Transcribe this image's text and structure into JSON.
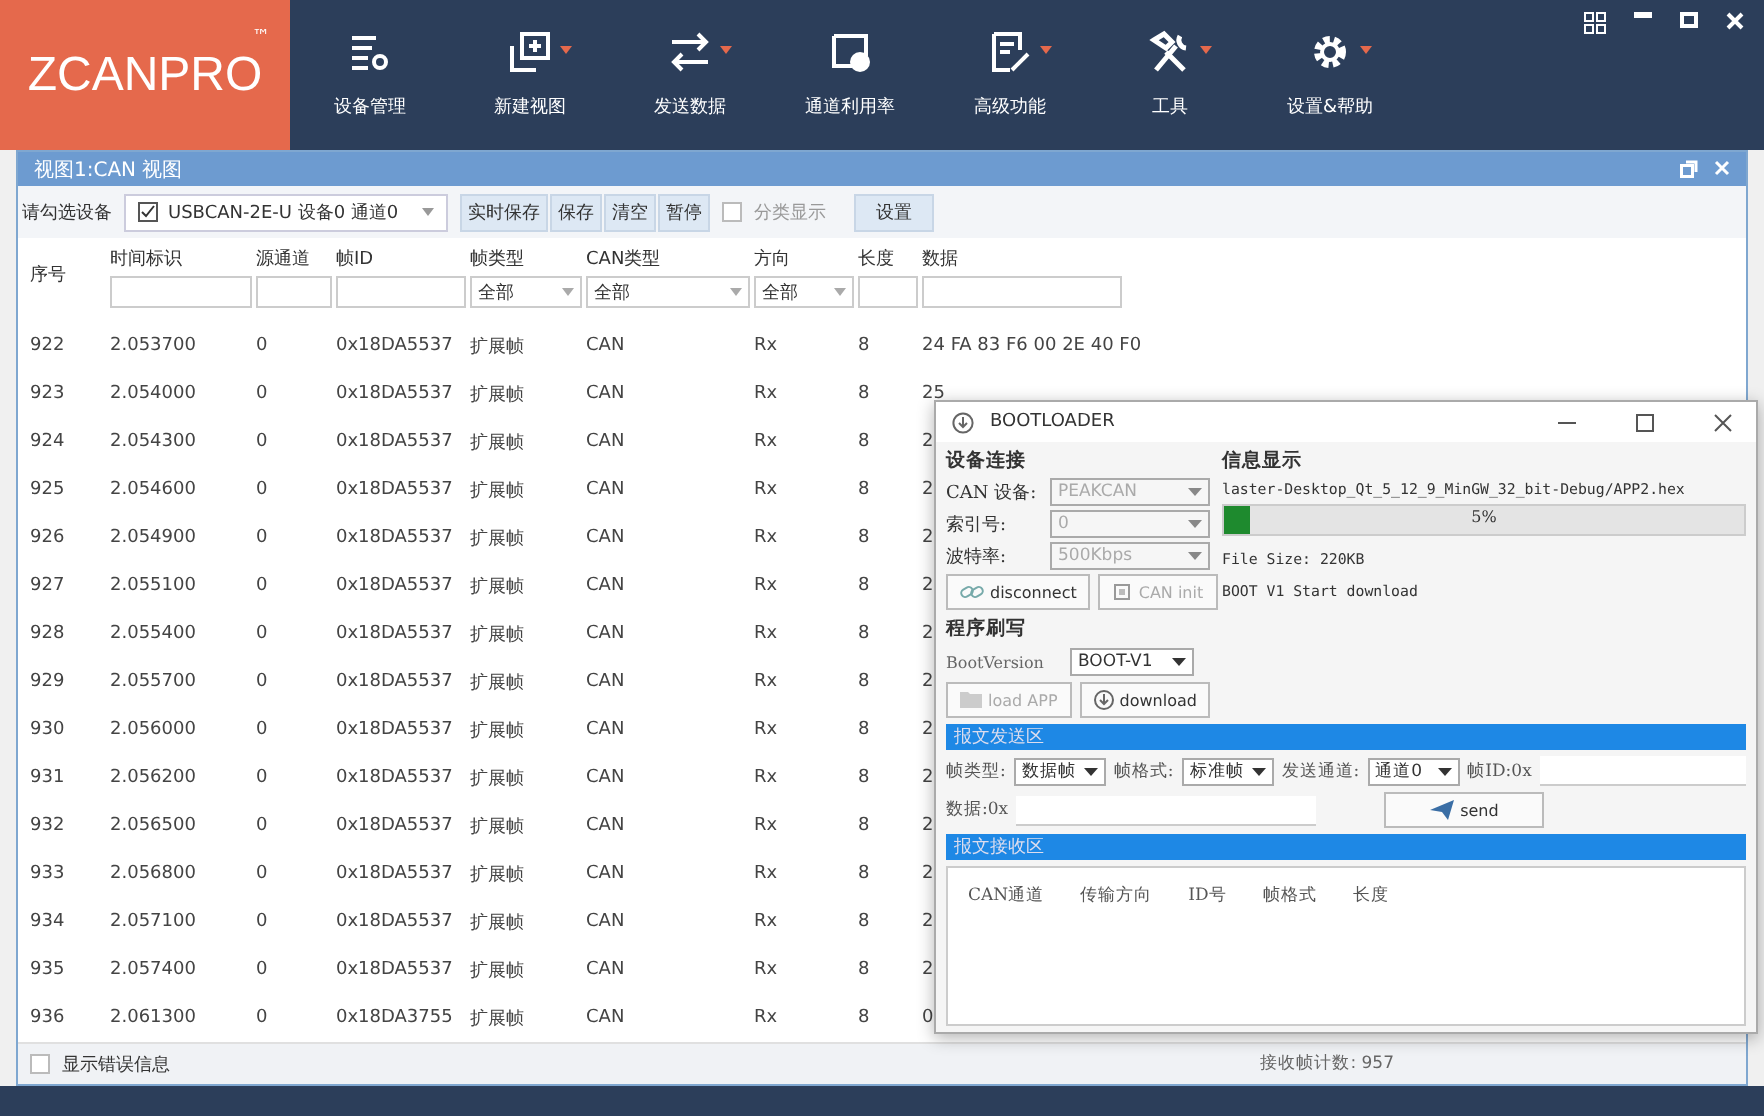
{
  "app": {
    "logo": "ZCANPRO",
    "logo_mark": "™",
    "toolbar": [
      {
        "label": "设备管理",
        "dropdown": false
      },
      {
        "label": "新建视图",
        "dropdown": true
      },
      {
        "label": "发送数据",
        "dropdown": true
      },
      {
        "label": "通道利用率",
        "dropdown": false
      },
      {
        "label": "高级功能",
        "dropdown": true
      },
      {
        "label": "工具",
        "dropdown": true
      },
      {
        "label": "设置&帮助",
        "dropdown": true
      }
    ]
  },
  "view": {
    "title": "视图1:CAN 视图",
    "device_label": "请勾选设备",
    "device": {
      "checked": true,
      "label": "USBCAN-2E-U 设备0 通道0"
    },
    "buttons": [
      "实时保存",
      "保存",
      "清空",
      "暂停"
    ],
    "classify": {
      "checked": false,
      "label": "分类显示"
    },
    "settings_button": "设置"
  },
  "table": {
    "columns": [
      {
        "label": "序号",
        "kind": "none"
      },
      {
        "label": "时间标识",
        "kind": "text"
      },
      {
        "label": "源通道",
        "kind": "text"
      },
      {
        "label": "帧ID",
        "kind": "text"
      },
      {
        "label": "帧类型",
        "kind": "select",
        "value": "全部"
      },
      {
        "label": "CAN类型",
        "kind": "select",
        "value": "全部"
      },
      {
        "label": "方向",
        "kind": "select",
        "value": "全部"
      },
      {
        "label": "长度",
        "kind": "text"
      },
      {
        "label": "数据",
        "kind": "text"
      }
    ],
    "rows": [
      [
        "922",
        "2.053700",
        "0",
        "0x18DA5537",
        "扩展帧",
        "CAN",
        "Rx",
        "8",
        "24 FA 83 F6 00 2E 40 F0"
      ],
      [
        "923",
        "2.054000",
        "0",
        "0x18DA5537",
        "扩展帧",
        "CAN",
        "Rx",
        "8",
        "25"
      ],
      [
        "924",
        "2.054300",
        "0",
        "0x18DA5537",
        "扩展帧",
        "CAN",
        "Rx",
        "8",
        "2"
      ],
      [
        "925",
        "2.054600",
        "0",
        "0x18DA5537",
        "扩展帧",
        "CAN",
        "Rx",
        "8",
        "2"
      ],
      [
        "926",
        "2.054900",
        "0",
        "0x18DA5537",
        "扩展帧",
        "CAN",
        "Rx",
        "8",
        "2"
      ],
      [
        "927",
        "2.055100",
        "0",
        "0x18DA5537",
        "扩展帧",
        "CAN",
        "Rx",
        "8",
        "2"
      ],
      [
        "928",
        "2.055400",
        "0",
        "0x18DA5537",
        "扩展帧",
        "CAN",
        "Rx",
        "8",
        "2"
      ],
      [
        "929",
        "2.055700",
        "0",
        "0x18DA5537",
        "扩展帧",
        "CAN",
        "Rx",
        "8",
        "2"
      ],
      [
        "930",
        "2.056000",
        "0",
        "0x18DA5537",
        "扩展帧",
        "CAN",
        "Rx",
        "8",
        "2"
      ],
      [
        "931",
        "2.056200",
        "0",
        "0x18DA5537",
        "扩展帧",
        "CAN",
        "Rx",
        "8",
        "2"
      ],
      [
        "932",
        "2.056500",
        "0",
        "0x18DA5537",
        "扩展帧",
        "CAN",
        "Rx",
        "8",
        "2"
      ],
      [
        "933",
        "2.056800",
        "0",
        "0x18DA5537",
        "扩展帧",
        "CAN",
        "Rx",
        "8",
        "2"
      ],
      [
        "934",
        "2.057100",
        "0",
        "0x18DA5537",
        "扩展帧",
        "CAN",
        "Rx",
        "8",
        "2"
      ],
      [
        "935",
        "2.057400",
        "0",
        "0x18DA5537",
        "扩展帧",
        "CAN",
        "Rx",
        "8",
        "2"
      ],
      [
        "936",
        "2.061300",
        "0",
        "0x18DA3755",
        "扩展帧",
        "CAN",
        "Rx",
        "8",
        "0"
      ]
    ]
  },
  "footer": {
    "show_errors": {
      "checked": false,
      "label": "显示错误信息"
    },
    "counters": [
      "接收帧计数: 957"
    ]
  },
  "bootloader": {
    "title": "BOOTLOADER",
    "connection_heading": "设备连接",
    "fields": [
      {
        "label": "CAN 设备:",
        "value": "PEAKCAN"
      },
      {
        "label": "索引号:",
        "value": "0"
      },
      {
        "label": "波特率:",
        "value": "500Kbps"
      }
    ],
    "connect_buttons": [
      {
        "label": "disconnect",
        "disabled": false
      },
      {
        "label": "CAN init",
        "disabled": true
      }
    ],
    "info_heading": "信息显示",
    "file_path": "laster-Desktop_Qt_5_12_9_MinGW_32_bit-Debug/APP2.hex",
    "progress": {
      "level": 0.05,
      "reading": "5%"
    },
    "messages": [
      "File Size: 220KB",
      "BOOT V1 Start download"
    ],
    "program_heading": "程序刷写",
    "boot_version_label": "BootVersion",
    "boot_version": "BOOT-V1",
    "program_buttons": [
      {
        "label": "load APP",
        "disabled": true
      },
      {
        "label": "download",
        "disabled": false
      }
    ],
    "send_heading": "报文发送区",
    "send_fields": [
      {
        "label": "帧类型:",
        "value": "数据帧"
      },
      {
        "label": "帧格式:",
        "value": "标准帧"
      },
      {
        "label": "发送通道:",
        "value": "通道0"
      }
    ],
    "frame_id_label": "帧ID:0x",
    "data_label": "数据:0x",
    "send_button": "send",
    "receive_heading": "报文接收区",
    "receive_columns": [
      "CAN通道",
      "传输方向",
      "ID号",
      "帧格式",
      "长度"
    ]
  }
}
